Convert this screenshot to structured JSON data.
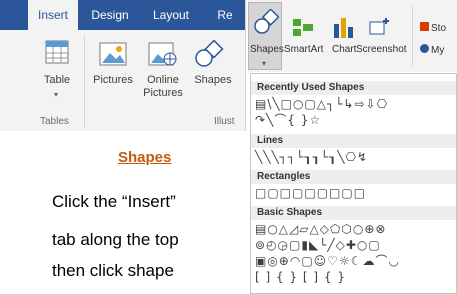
{
  "ribbon": {
    "tabs": [
      "Insert",
      "Design",
      "Layout",
      "Re"
    ],
    "buttons": {
      "table": "Table",
      "pictures": "Pictures",
      "online_pictures": "Online Pictures",
      "shapes": "Shapes"
    },
    "groups": {
      "tables": "Tables",
      "illustrations": "Illust"
    },
    "tab_color": "#2b579a"
  },
  "title": "Shapes",
  "instructions": [
    "Click the “Insert”",
    "tab along the top",
    "then click shape"
  ],
  "gallery": {
    "top_buttons": [
      "Shapes",
      "SmartArt",
      "Chart",
      "Screenshot"
    ],
    "side_items": [
      "Sto",
      "My"
    ],
    "sections": [
      {
        "label": "Recently Used Shapes",
        "rows": [
          "▤\\╲□○▢△┐└↳⇨⇩⎔",
          "↷╲⌒{ }☆"
        ]
      },
      {
        "label": "Lines",
        "rows": [
          "╲╲╲┐┐└┒┒└┒╲⎔↯"
        ]
      },
      {
        "label": "Rectangles",
        "rows": [
          "□▢□▢□▢□▢□"
        ]
      },
      {
        "label": "Basic Shapes",
        "rows": [
          "▤○△◿▱△◇⬠⬡○⊕⊗",
          "⊚◴◶▢▮◣└╱◇✚○▢",
          "▣◎⊕◠▢☺♡☼☾☁⌒◡",
          "[ ] { } [ ] { }"
        ]
      }
    ]
  }
}
